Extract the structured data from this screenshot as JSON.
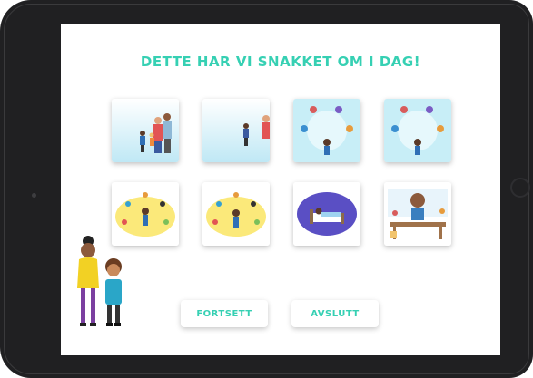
{
  "screen": {
    "title": "DETTE HAR VI SNAKKET OM I DAG!"
  },
  "cards": [
    {
      "id": "family",
      "scene": "people-standing"
    },
    {
      "id": "family-right",
      "scene": "people-standing-right"
    },
    {
      "id": "circle-group",
      "scene": "children-circle"
    },
    {
      "id": "circle-group-2",
      "scene": "children-circle"
    },
    {
      "id": "emotions-1",
      "scene": "child-with-feeling-icons"
    },
    {
      "id": "emotions-2",
      "scene": "child-with-feeling-icons"
    },
    {
      "id": "bedtime",
      "scene": "child-in-bed"
    },
    {
      "id": "classroom",
      "scene": "teacher-and-class"
    }
  ],
  "buttons": {
    "continue_label": "FORTSETT",
    "quit_label": "AVSLUTT"
  },
  "colors": {
    "accent": "#36d0b3",
    "sky": "#bfe8f5",
    "yellow": "#fbe97a",
    "night": "#5a4fc4"
  }
}
